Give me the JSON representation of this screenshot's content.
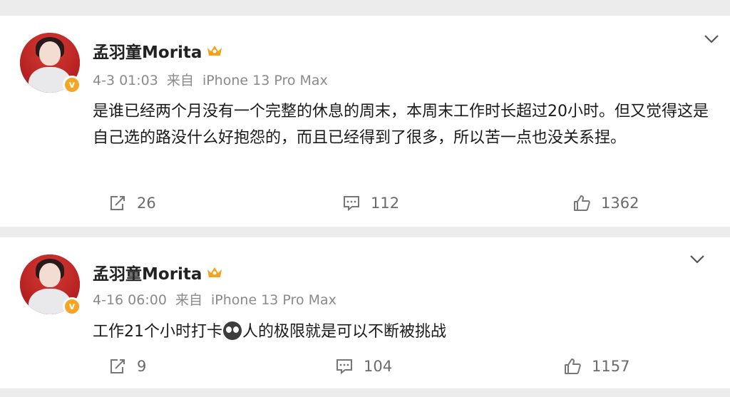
{
  "posts": [
    {
      "username": "孟羽童Morita",
      "date": "4-3 01:03",
      "source_prefix": "来自",
      "device": "iPhone 13 Pro Max",
      "text": "是谁已经两个月没有一个完整的休息的周末，本周末工作时长超过20小时。但又觉得这是自己选的路没什么好抱怨的，而且已经得到了很多，所以苦一点也没关系捏。",
      "reposts": "26",
      "comments": "112",
      "likes": "1362"
    },
    {
      "username": "孟羽童Morita",
      "date": "4-16 06:00",
      "source_prefix": "来自",
      "device": "iPhone 13 Pro Max",
      "text_before_emoji": "工作21个小时打卡",
      "text_after_emoji": "人的极限就是可以不断被挑战",
      "reposts": "9",
      "comments": "104",
      "likes": "1157"
    }
  ],
  "icons": {
    "verified": "verified-badge-icon",
    "crown": "crown-icon",
    "more": "chevron-down-icon",
    "repost": "repost-icon",
    "comment": "comment-icon",
    "like": "thumbs-up-icon"
  },
  "colors": {
    "verified_badge": "#f6a623",
    "crown": "#f2a21b",
    "text_primary": "#1a1a1a",
    "text_meta": "#8a8a8a",
    "background": "#ececec"
  }
}
